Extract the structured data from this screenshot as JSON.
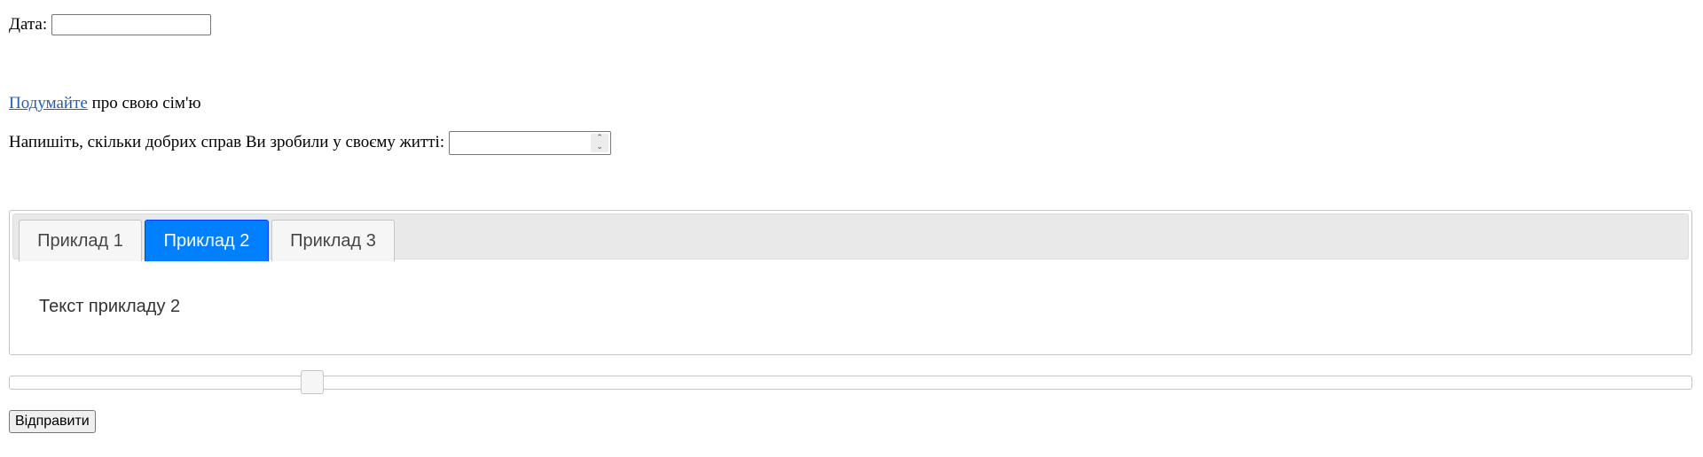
{
  "date_field": {
    "label": "Дата:",
    "value": ""
  },
  "think": {
    "link_text": "Подумайте",
    "rest_text": " про свою сім'ю"
  },
  "good_deeds": {
    "label": "Напишіть, скільки добрих справ Ви зробили у своєму житті:",
    "value": "",
    "up_icon": "⌃",
    "down_icon": "⌄"
  },
  "tabs": {
    "items": [
      {
        "label": "Приклад 1"
      },
      {
        "label": "Приклад 2"
      },
      {
        "label": "Приклад 3"
      }
    ],
    "active_index": 1,
    "panel_text": "Текст прикладу 2"
  },
  "slider": {
    "fraction": 0.18
  },
  "submit": {
    "label": "Відправити"
  },
  "colors": {
    "link": "#1f5fbf",
    "active_tab_bg": "#007fff",
    "active_tab_border": "#003eff",
    "tab_bar_bg": "#e9e9e9"
  }
}
